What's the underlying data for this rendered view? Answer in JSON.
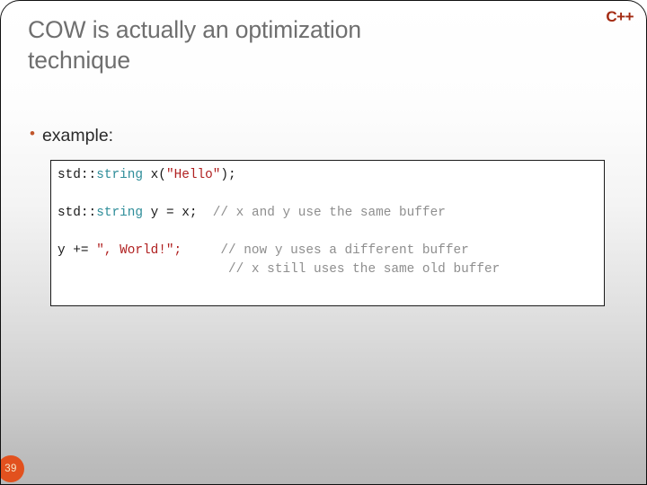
{
  "slide": {
    "title": "COW is actually an optimization\ntechnique",
    "logo_text": "C++",
    "page_number": "39",
    "bullet": {
      "marker": "•",
      "text": "example:"
    },
    "colors": {
      "title": "#6f6f6f",
      "logo": "#a32a12",
      "bullet_marker": "#c0562c",
      "badge_bg": "#e2511e",
      "code_type": "#2e8d99",
      "code_string": "#b02020",
      "code_comment": "#8e8e8e",
      "code_plain": "#1a1a1a",
      "code_border": "#1b1b1b"
    }
  },
  "code_block": {
    "language": "cpp",
    "lines": [
      {
        "id": "line-1",
        "tokens": [
          {
            "kind": "plain",
            "text": "std"
          },
          {
            "kind": "plain",
            "text": "::"
          },
          {
            "kind": "type",
            "text": "string"
          },
          {
            "kind": "plain",
            "text": " x("
          },
          {
            "kind": "string",
            "text": "\"Hello\""
          },
          {
            "kind": "plain",
            "text": ");"
          }
        ],
        "plain_text": "std::string x(\"Hello\");"
      },
      {
        "id": "gap-1",
        "tokens": [],
        "plain_text": ""
      },
      {
        "id": "line-2",
        "tokens": [
          {
            "kind": "plain",
            "text": "std"
          },
          {
            "kind": "plain",
            "text": "::"
          },
          {
            "kind": "type",
            "text": "string"
          },
          {
            "kind": "plain",
            "text": " y = x;  "
          },
          {
            "kind": "comment",
            "text": "// x and y use the same buffer"
          }
        ],
        "plain_text": "std::string y = x;  // x and y use the same buffer"
      },
      {
        "id": "gap-2",
        "tokens": [],
        "plain_text": ""
      },
      {
        "id": "line-3",
        "tokens": [
          {
            "kind": "plain",
            "text": "y += "
          },
          {
            "kind": "string",
            "text": "\", World!\";"
          },
          {
            "kind": "plain",
            "text": "     "
          },
          {
            "kind": "comment",
            "text": "// now y uses a different buffer"
          }
        ],
        "plain_text": "y += \", World!\";     // now y uses a different buffer"
      },
      {
        "id": "line-4",
        "tokens": [
          {
            "kind": "plain",
            "text": "                      "
          },
          {
            "kind": "comment",
            "text": "// x still uses the same old buffer"
          }
        ],
        "plain_text": "                      // x still uses the same old buffer"
      }
    ]
  }
}
